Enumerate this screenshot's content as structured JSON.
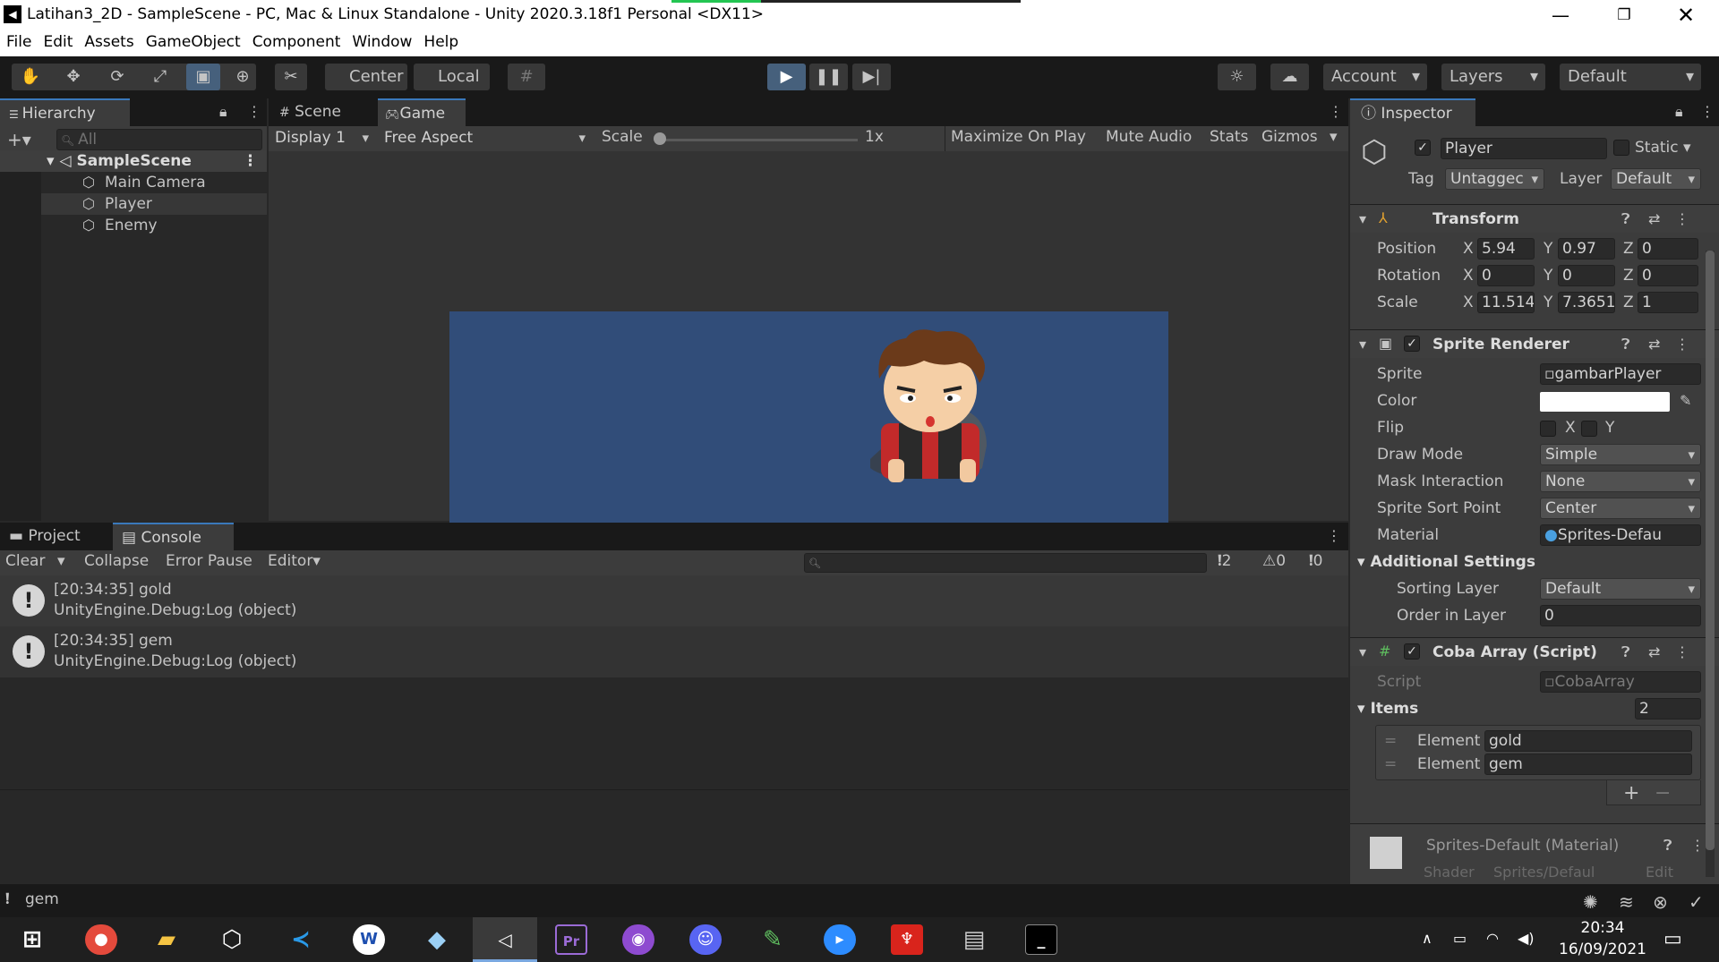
{
  "window": {
    "title": "Latihan3_2D - SampleScene - PC, Mac & Linux Standalone - Unity 2020.3.18f1 Personal <DX11>",
    "logo": "unity-logo"
  },
  "menu": [
    "File",
    "Edit",
    "Assets",
    "GameObject",
    "Component",
    "Window",
    "Help"
  ],
  "toolbar": {
    "center": "Center",
    "local": "Local",
    "account": "Account",
    "layers": "Layers",
    "layout": "Default"
  },
  "hierarchy": {
    "tab": "Hierarchy",
    "search_placeholder": "All",
    "scene": "SampleScene",
    "items": [
      "Main Camera",
      "Player",
      "Enemy"
    ]
  },
  "game": {
    "tabs": [
      "Scene",
      "Game"
    ],
    "display": "Display 1",
    "aspect": "Free Aspect",
    "scale_label": "Scale",
    "scale_value": "1x",
    "buttons": [
      "Maximize On Play",
      "Mute Audio",
      "Stats",
      "Gizmos"
    ],
    "bg_color": "#314d79"
  },
  "console": {
    "tabs": [
      "Project",
      "Console"
    ],
    "buttons": [
      "Clear",
      "Collapse",
      "Error Pause",
      "Editor"
    ],
    "counts": {
      "log": "2",
      "warn": "0",
      "error": "0"
    },
    "entries": [
      {
        "line1": "[20:34:35] gold",
        "line2": "UnityEngine.Debug:Log (object)"
      },
      {
        "line1": "[20:34:35] gem",
        "line2": "UnityEngine.Debug:Log (object)"
      }
    ]
  },
  "inspector": {
    "tab": "Inspector",
    "name": "Player",
    "static": "Static",
    "tag_label": "Tag",
    "tag": "Untaggec",
    "layer_label": "Layer",
    "layer": "Default",
    "transform": {
      "title": "Transform",
      "position_label": "Position",
      "rotation_label": "Rotation",
      "scale_label": "Scale",
      "position": {
        "x": "5.94",
        "y": "0.97",
        "z": "0"
      },
      "rotation": {
        "x": "0",
        "y": "0",
        "z": "0"
      },
      "scale": {
        "x": "11.514",
        "y": "7.3651",
        "z": "1"
      }
    },
    "sprite_renderer": {
      "title": "Sprite Renderer",
      "sprite_label": "Sprite",
      "sprite": "gambarPlayer",
      "color_label": "Color",
      "flip_label": "Flip",
      "flip_x": "X",
      "flip_y": "Y",
      "draw_mode_label": "Draw Mode",
      "draw_mode": "Simple",
      "mask_label": "Mask Interaction",
      "mask": "None",
      "sort_point_label": "Sprite Sort Point",
      "sort_point": "Center",
      "material_label": "Material",
      "material": "Sprites-Defau",
      "additional": "Additional Settings",
      "sorting_layer_label": "Sorting Layer",
      "sorting_layer": "Default",
      "order_label": "Order in Layer",
      "order": "0"
    },
    "script": {
      "title": "Coba Array (Script)",
      "script_label": "Script",
      "script": "CobaArray",
      "items_label": "Items",
      "items_count": "2",
      "elements": [
        {
          "label": "Element",
          "value": "gold"
        },
        {
          "label": "Element",
          "value": "gem"
        }
      ]
    },
    "material": {
      "title": "Sprites-Default (Material)",
      "shader_label": "Shader",
      "shader": "Sprites/Defaul",
      "edit": "Edit"
    }
  },
  "status": {
    "message": "gem"
  },
  "taskbar": {
    "time": "20:34",
    "date": "16/09/2021"
  }
}
